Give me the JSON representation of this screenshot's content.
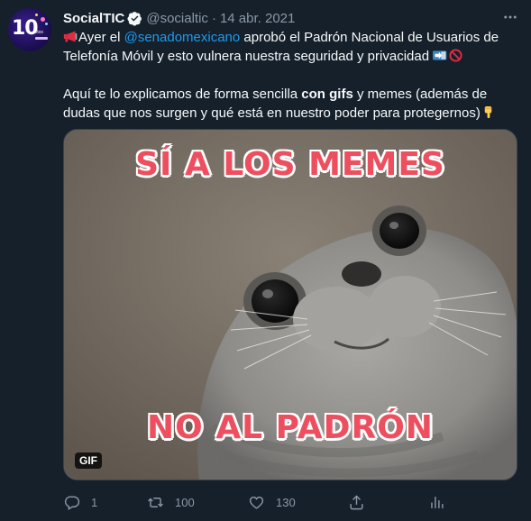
{
  "tweet": {
    "author_name": "SocialTIC",
    "handle": "@socialtic",
    "separator": "·",
    "date": "14 abr. 2021",
    "avatar": {
      "main_text": "10",
      "sub_text": "años"
    },
    "text": {
      "p1_pre": "Ayer el ",
      "p1_mention": "@senadomexicano",
      "p1_post": " aprobó el Padrón Nacional de Usuarios de Telefonía Móvil y esto vulnera nuestra seguridad y privacidad ",
      "p2_pre": "Aquí te lo explicamos de forma sencilla ",
      "p2_bold": "con gifs",
      "p2_post": " y memes (además de dudas que nos surgen y qué está en nuestro poder para protegernos)"
    },
    "media": {
      "caption_top": "SÍ A LOS MEMES",
      "caption_bottom": "NO AL PADRÓN",
      "badge": "GIF"
    },
    "actions": {
      "reply_count": "1",
      "retweet_count": "100",
      "like_count": "130",
      "share_count": "",
      "analytics_count": ""
    }
  },
  "icons": [
    "verified-badge-icon",
    "more-icon",
    "megaphone-icon",
    "arrow-right-icon",
    "no-entry-icon",
    "pointing-down-icon",
    "reply-icon",
    "retweet-icon",
    "like-icon",
    "share-icon",
    "analytics-icon"
  ],
  "colors": {
    "background": "#15202b",
    "text_primary": "#f7f9f9",
    "text_secondary": "#8b98a5",
    "mention": "#1d9bf0",
    "caption": "#ee4f5f"
  }
}
